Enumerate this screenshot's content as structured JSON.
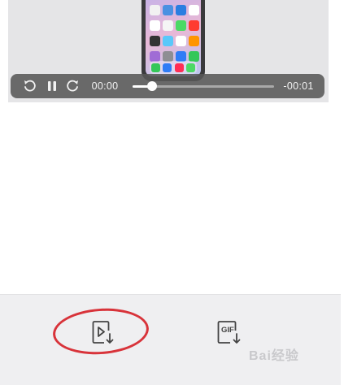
{
  "player": {
    "current_time": "00:00",
    "remaining_time": "-00:01",
    "progress": 0.14,
    "icons": {
      "rewind": "rewind-icon",
      "pause": "pause-icon",
      "forward": "forward-icon"
    }
  },
  "toolbar": {
    "save_video_icon": "save-video-icon",
    "save_gif_icon": "save-gif-icon",
    "gif_text": "GIF"
  },
  "annotation": {
    "highlight_color": "#d8333a"
  },
  "watermark": {
    "text": "Bai经验"
  }
}
